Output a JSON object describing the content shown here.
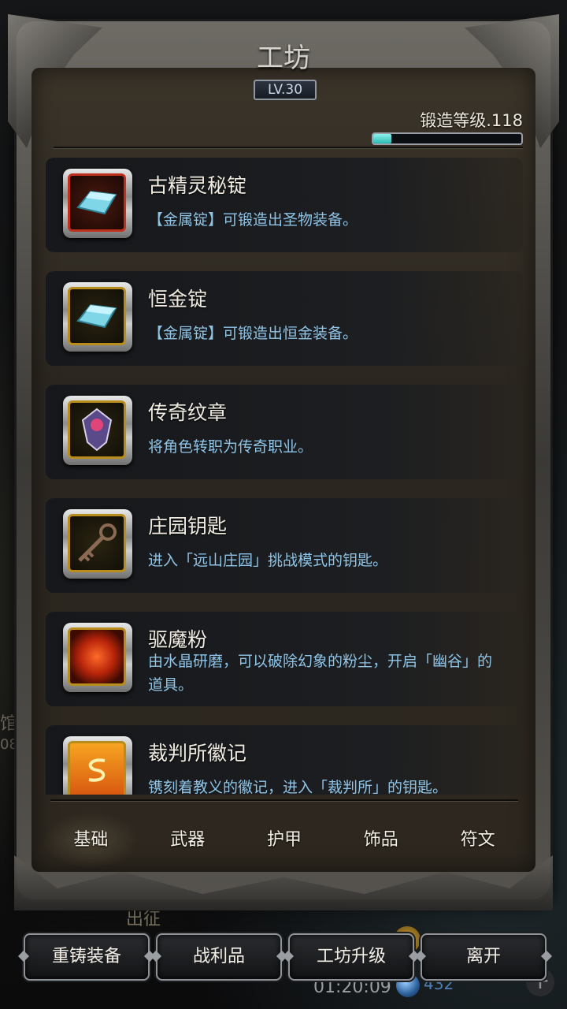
{
  "background": {
    "left_text_1": "馆",
    "left_text_2": "08",
    "expedition_label": "出征",
    "timer": "01:20:09",
    "gem_count": "432"
  },
  "panel": {
    "title": "工坊",
    "level": "LV.30",
    "forge_level_label": "锻造等级.118",
    "forge_progress": 0.12
  },
  "items": [
    {
      "name": "古精灵秘锭",
      "desc": "【金属锭】可锻造出圣物装备。",
      "icon": "crystal-ingot-icon",
      "frame": "red"
    },
    {
      "name": "恒金锭",
      "desc": "【金属锭】可锻造出恒金装备。",
      "icon": "crystal-ingot-icon",
      "frame": "gold"
    },
    {
      "name": "传奇纹章",
      "desc": "将角色转职为传奇职业。",
      "icon": "crest-gem-icon",
      "frame": "gold"
    },
    {
      "name": "庄园钥匙",
      "desc": "进入「远山庄园」挑战模式的钥匙。",
      "icon": "key-icon",
      "frame": "gold"
    },
    {
      "name": "驱魔粉",
      "desc": "由水晶研磨，可以破除幻象的粉尘，开启「幽谷」的道具。",
      "icon": "powder-icon",
      "frame": "gold"
    },
    {
      "name": "裁判所徽记",
      "desc": "镌刻着教义的徽记，进入「裁判所」的钥匙。",
      "icon": "emblem-icon",
      "frame": "gold"
    }
  ],
  "tabs": [
    "基础",
    "武器",
    "护甲",
    "饰品",
    "符文"
  ],
  "active_tab": "基础",
  "buttons": {
    "reforge": "重铸装备",
    "loot": "战利品",
    "upgrade": "工坊升级",
    "leave": "离开"
  },
  "colors": {
    "desc_text": "#8fc4e6",
    "progress_fill": "#2bb9b2",
    "gold_frame": "#b88d1c",
    "red_frame": "#c0311d"
  }
}
